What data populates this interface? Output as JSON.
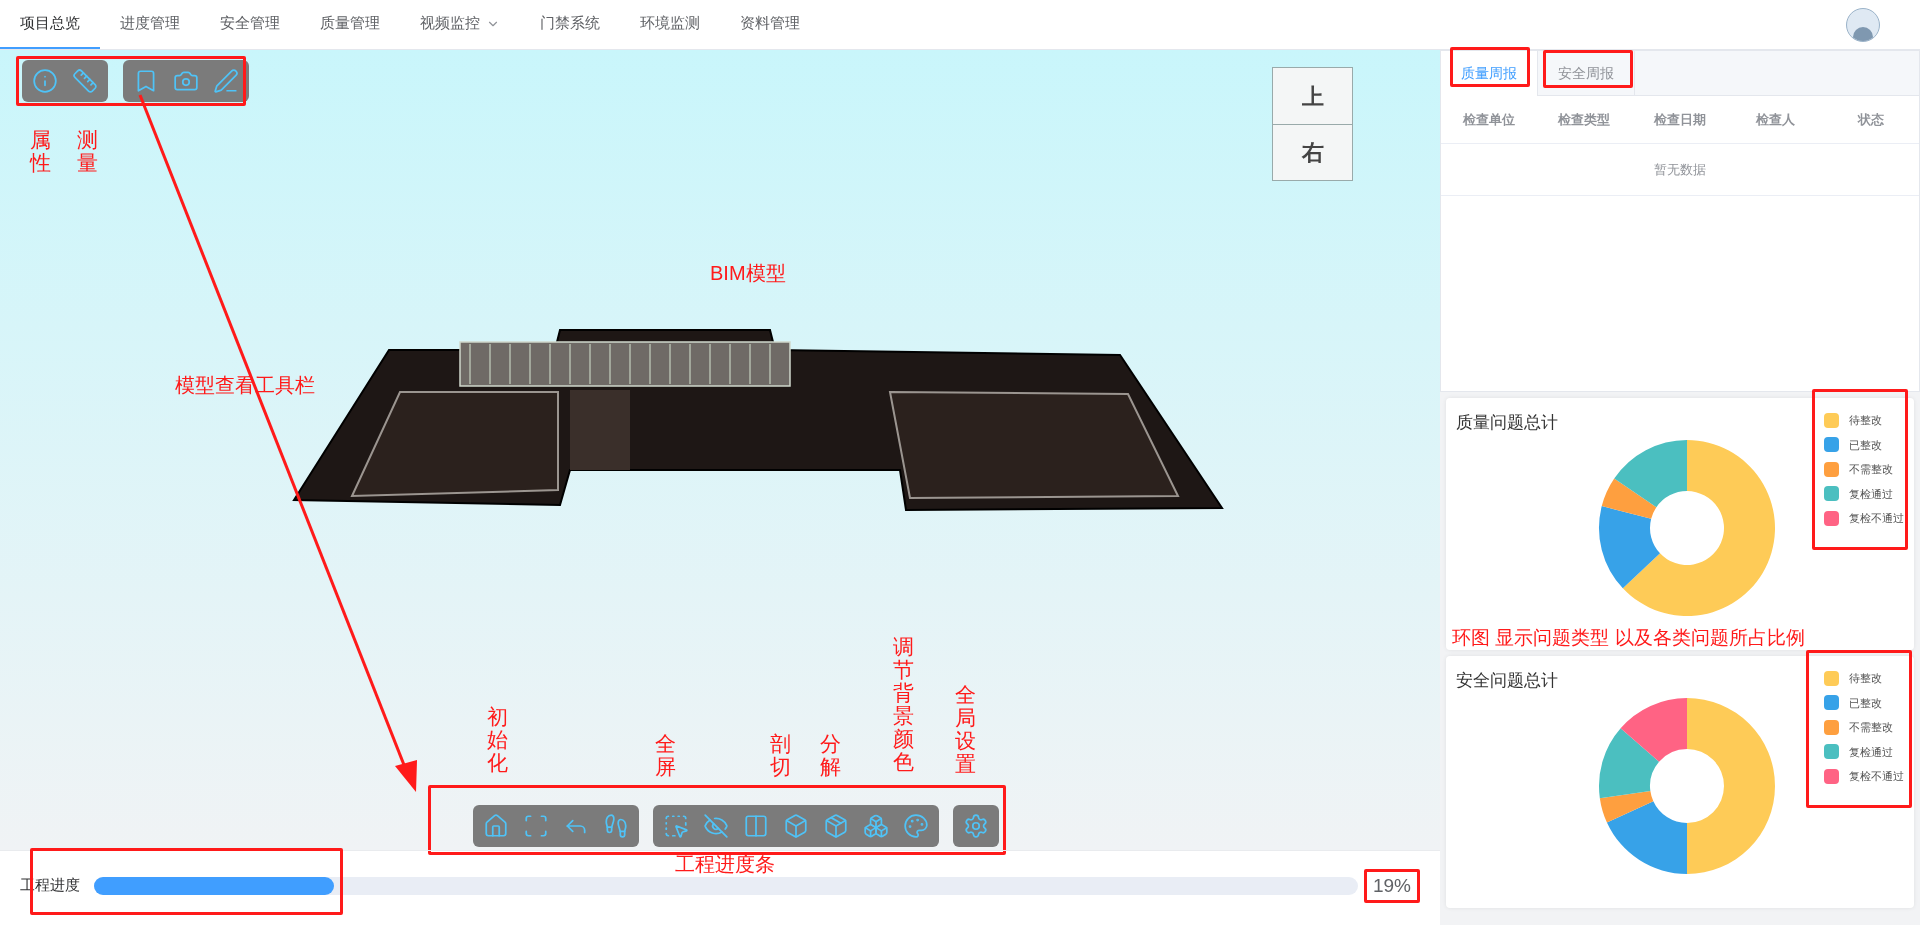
{
  "nav": {
    "tabs": [
      {
        "label": "项目总览",
        "selected": true,
        "dropdown": false
      },
      {
        "label": "进度管理",
        "selected": false,
        "dropdown": false
      },
      {
        "label": "安全管理",
        "selected": false,
        "dropdown": false
      },
      {
        "label": "质量管理",
        "selected": false,
        "dropdown": false
      },
      {
        "label": "视频监控",
        "selected": false,
        "dropdown": true
      },
      {
        "label": "门禁系统",
        "selected": false,
        "dropdown": false
      },
      {
        "label": "环境监测",
        "selected": false,
        "dropdown": false
      },
      {
        "label": "资料管理",
        "selected": false,
        "dropdown": false
      }
    ]
  },
  "nav_cube": {
    "faces": [
      "上",
      "右"
    ]
  },
  "annotations": {
    "attribute": "属性",
    "measure": "测量",
    "toolbar": "模型查看工具栏",
    "model": "BIM模型",
    "init": "初始化",
    "fullscreen": "全屏",
    "section": "剖切",
    "explode": "分解",
    "background": "调节背景颜色",
    "settings": "全局设置",
    "progress": "工程进度条",
    "donut": "环图 显示问题类型 以及各类问题所占比例"
  },
  "progress": {
    "label": "工程进度",
    "level": 0.19,
    "reading": "19%"
  },
  "report": {
    "tabs": [
      {
        "label": "质量周报",
        "selected": true
      },
      {
        "label": "安全周报",
        "selected": false
      }
    ],
    "columns": [
      "检查单位",
      "检查类型",
      "检查日期",
      "检查人",
      "状态"
    ],
    "empty_text": "暂无数据"
  },
  "charts": [
    {
      "title": "质量问题总计",
      "legend": [
        {
          "label": "待整改",
          "color": "#fecb57"
        },
        {
          "label": "已整改",
          "color": "#37a2e8"
        },
        {
          "label": "不需整改",
          "color": "#fe9f3f"
        },
        {
          "label": "复检通过",
          "color": "#4bbfc0"
        },
        {
          "label": "复检不通过",
          "color": "#ff6384"
        }
      ]
    },
    {
      "title": "安全问题总计",
      "legend": [
        {
          "label": "待整改",
          "color": "#fecb57"
        },
        {
          "label": "已整改",
          "color": "#37a2e8"
        },
        {
          "label": "不需整改",
          "color": "#fe9f3f"
        },
        {
          "label": "复检通过",
          "color": "#4bbfc0"
        },
        {
          "label": "复检不通过",
          "color": "#ff6384"
        }
      ]
    }
  ]
}
